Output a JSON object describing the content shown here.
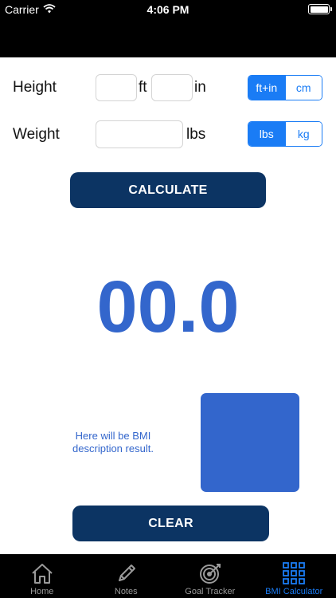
{
  "status_bar": {
    "carrier": "Carrier",
    "time": "4:06 PM"
  },
  "height": {
    "label": "Height",
    "feet_unit": "ft",
    "inches_unit": "in",
    "unit_options": [
      "ft+in",
      "cm"
    ],
    "selected_unit": "ft+in"
  },
  "weight": {
    "label": "Weight",
    "unit": "lbs",
    "unit_options": [
      "lbs",
      "kg"
    ],
    "selected_unit": "lbs"
  },
  "calculate_label": "CALCULATE",
  "bmi_value": "00.0",
  "description": "Here will be BMI description result.",
  "clear_label": "CLEAR",
  "colors": {
    "accent": "#1a7cf5",
    "button": "#0c3463",
    "result": "#3366cc"
  },
  "tabs": [
    {
      "label": "Home",
      "icon": "home-icon"
    },
    {
      "label": "Notes",
      "icon": "pencil-icon"
    },
    {
      "label": "Goal Tracker",
      "icon": "target-icon"
    },
    {
      "label": "BMI Calculator",
      "icon": "grid-icon",
      "active": true
    }
  ]
}
